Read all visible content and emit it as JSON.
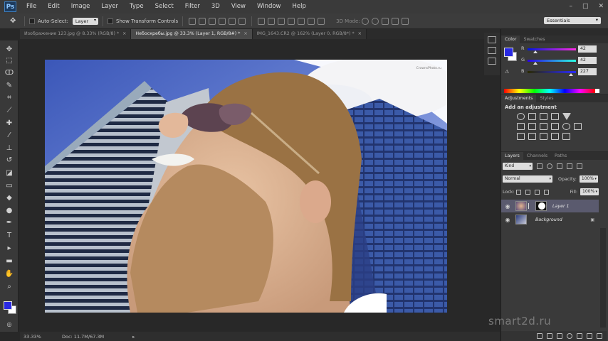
{
  "app": {
    "logo": "Ps",
    "menu": [
      "File",
      "Edit",
      "Image",
      "Layer",
      "Type",
      "Select",
      "Filter",
      "3D",
      "View",
      "Window",
      "Help"
    ],
    "window_controls": [
      "–",
      "□",
      "✕"
    ]
  },
  "options_bar": {
    "auto_select_label": "Auto-Select:",
    "auto_select_value": "Layer",
    "show_transform_label": "Show Transform Controls",
    "mode_3d_label": "3D Mode:",
    "workspace": "Essentials"
  },
  "tabs": [
    {
      "label": "Изображение 123.jpg @ 8.33% (RGB/8) *",
      "close": "×",
      "active": false
    },
    {
      "label": "Небоскребы.jpg @ 33.3% (Layer 1, RGB/8#) *",
      "close": "×",
      "active": true
    },
    {
      "label": "IMG_1643.CR2 @ 162% (Layer 0, RGB/8*) *",
      "close": "×",
      "active": false
    }
  ],
  "tabs_overflow": "»",
  "toolbar": {
    "tools": [
      {
        "name": "move-tool-icon",
        "glyph": "✥"
      },
      {
        "name": "marquee-tool-icon",
        "glyph": "⬚"
      },
      {
        "name": "lasso-tool-icon",
        "glyph": "ↀ"
      },
      {
        "name": "quick-select-tool-icon",
        "glyph": "✎"
      },
      {
        "name": "crop-tool-icon",
        "glyph": "⌗"
      },
      {
        "name": "eyedropper-tool-icon",
        "glyph": "⟋"
      },
      {
        "name": "healing-brush-tool-icon",
        "glyph": "✚"
      },
      {
        "name": "brush-tool-icon",
        "glyph": "⁄"
      },
      {
        "name": "clone-stamp-tool-icon",
        "glyph": "⊥"
      },
      {
        "name": "history-brush-tool-icon",
        "glyph": "↺"
      },
      {
        "name": "eraser-tool-icon",
        "glyph": "◪"
      },
      {
        "name": "gradient-tool-icon",
        "glyph": "▭"
      },
      {
        "name": "blur-tool-icon",
        "glyph": "◆"
      },
      {
        "name": "dodge-tool-icon",
        "glyph": "●"
      },
      {
        "name": "pen-tool-icon",
        "glyph": "✒"
      },
      {
        "name": "type-tool-icon",
        "glyph": "T"
      },
      {
        "name": "path-select-tool-icon",
        "glyph": "▸"
      },
      {
        "name": "shape-tool-icon",
        "glyph": "▬"
      },
      {
        "name": "hand-tool-icon",
        "glyph": "✋"
      },
      {
        "name": "zoom-tool-icon",
        "glyph": "⌕"
      }
    ]
  },
  "canvas": {
    "watermark": "CrownsPhoto.ru"
  },
  "status": {
    "zoom": "33.33%",
    "doc": "Doc: 11.7M/67.3M",
    "arrow": "▸"
  },
  "color_panel": {
    "tabs": [
      "Color",
      "Swatches"
    ],
    "channels": [
      {
        "label": "R",
        "value": "42",
        "fraction": 0.16
      },
      {
        "label": "G",
        "value": "42",
        "fraction": 0.16
      },
      {
        "label": "B",
        "value": "227",
        "fraction": 0.89
      }
    ],
    "fg_color": "#2a2ae3",
    "bg_color": "#ffffff"
  },
  "adjustments_panel": {
    "tabs": [
      "Adjustments",
      "Styles"
    ],
    "title": "Add an adjustment"
  },
  "layers_panel": {
    "tabs": [
      "Layers",
      "Channels",
      "Paths"
    ],
    "kind": "Kind",
    "blend_mode": "Normal",
    "opacity_label": "Opacity:",
    "opacity": "100%",
    "lock_label": "Lock:",
    "fill_label": "Fill:",
    "fill": "100%",
    "layers": [
      {
        "name": "Layer 1",
        "selected": true,
        "has_mask": true,
        "locked": false
      },
      {
        "name": "Background",
        "selected": false,
        "has_mask": false,
        "locked": true
      }
    ],
    "layer_lock_glyph": "🔒"
  },
  "brand": "smart2d.ru"
}
